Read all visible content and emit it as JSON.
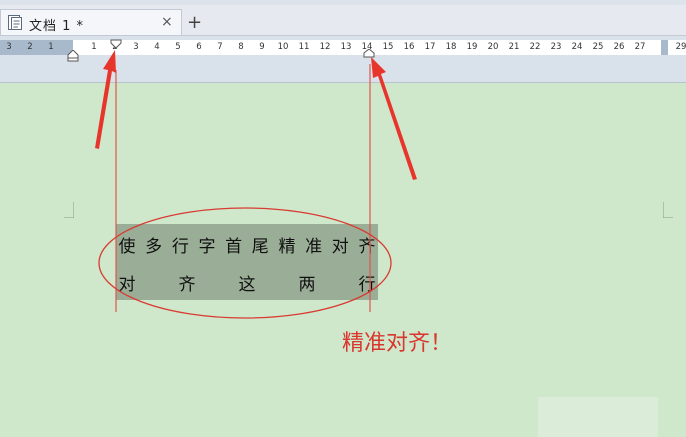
{
  "tab": {
    "title": "文档 1 *",
    "close": "×",
    "new": "+"
  },
  "ruler": {
    "numbers": [
      "3",
      "2",
      "1",
      "1",
      "2",
      "3",
      "4",
      "5",
      "6",
      "7",
      "8",
      "9",
      "10",
      "11",
      "12",
      "13",
      "14",
      "15",
      "16",
      "17",
      "18",
      "19",
      "20",
      "21",
      "22",
      "23",
      "24",
      "25",
      "26",
      "27",
      "29"
    ]
  },
  "document": {
    "line1": [
      "使",
      "多",
      "行",
      "字",
      "首",
      "尾",
      "精",
      "准",
      "对",
      "齐"
    ],
    "line2": [
      "对",
      "齐",
      "这",
      "两",
      "行"
    ]
  },
  "annotation": {
    "text": "精准对齐！"
  },
  "colors": {
    "accent": "#d9362e",
    "page": "#cfe7cb",
    "selection": "#9aad96"
  }
}
